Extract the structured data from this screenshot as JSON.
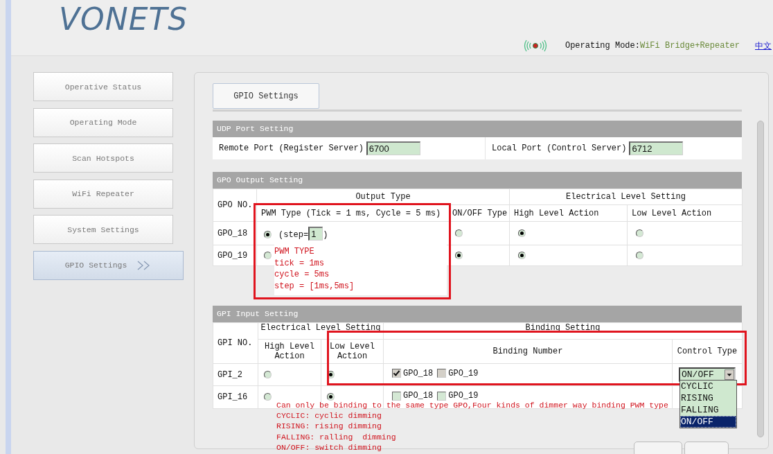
{
  "header": {
    "logo": "VONETS",
    "mode_label": "Operating Mode:",
    "mode_value": "WiFi Bridge+Repeater",
    "language_link": "中文"
  },
  "sidebar": {
    "items": [
      {
        "label": "Operative Status",
        "selected": false
      },
      {
        "label": "Operating Mode",
        "selected": false
      },
      {
        "label": "Scan Hotspots",
        "selected": false
      },
      {
        "label": "WiFi Repeater",
        "selected": false
      },
      {
        "label": "System Settings",
        "selected": false
      },
      {
        "label": "GPIO Settings",
        "selected": true
      }
    ]
  },
  "tabs": [
    {
      "label": "GPIO Settings",
      "selected": true
    }
  ],
  "udp": {
    "title": "UDP Port Setting",
    "remote_label": "Remote Port (Register Server)",
    "remote_value": "6700",
    "local_label": "Local Port (Control Server)",
    "local_value": "6712"
  },
  "gpo": {
    "title": "GPO Output Setting",
    "col_no": "GPO NO.",
    "col_output": "Output Type",
    "col_level": "Electrical Level Setting",
    "col_pwm": "PWM Type (Tick = 1 ms, Cycle = 5 ms)",
    "col_onoff": "ON/OFF Type",
    "col_high": "High Level Action",
    "col_low": "Low Level Action",
    "rows": [
      {
        "name": "GPO_18",
        "pwm_selected": true,
        "step_prefix": "(step=",
        "step": "1",
        "step_suffix": ")",
        "onoff_selected": false,
        "high_selected": true,
        "low_selected": false
      },
      {
        "name": "GPO_19",
        "pwm_selected": false,
        "onoff_selected": true,
        "high_selected": true,
        "low_selected": false
      }
    ]
  },
  "tooltip": {
    "lines": [
      "PWM TYPE",
      "tick = 1ms",
      "cycle = 5ms",
      "step = [1ms,5ms]"
    ]
  },
  "gpi": {
    "title": "GPI Input Setting",
    "col_no": "GPI NO.",
    "col_level": "Electrical Level Setting",
    "col_binding": "Binding Setting",
    "col_high": "High Level Action",
    "col_low": "Low Level Action",
    "col_number": "Binding Number",
    "col_control": "Control Type",
    "rows": [
      {
        "name": "GPI_2",
        "high_selected": false,
        "low_selected": true,
        "bindings": [
          {
            "label": "GPO_18",
            "checked": true,
            "disabled": true
          },
          {
            "label": "GPO_19",
            "checked": false,
            "disabled": true
          }
        ],
        "control": "ON/OFF"
      },
      {
        "name": "GPI_16",
        "high_selected": false,
        "low_selected": true,
        "bindings": [
          {
            "label": "GPO_18",
            "checked": false,
            "disabled": false
          },
          {
            "label": "GPO_19",
            "checked": false,
            "disabled": false
          }
        ]
      }
    ]
  },
  "dropdown": {
    "options": [
      {
        "label": "CYCLIC",
        "selected": false
      },
      {
        "label": "RISING",
        "selected": false
      },
      {
        "label": "FALLING",
        "selected": false
      },
      {
        "label": "ON/OFF",
        "selected": true
      }
    ]
  },
  "note": {
    "lines": [
      "Can only be binding to the same type GPO,Four kinds of dimmer way binding PWM type",
      "CYCLIC: cyclic dimming",
      "RISING: rising dimming",
      "FALLING: ralling  dimming",
      "ON/OFF: switch dimming"
    ]
  }
}
